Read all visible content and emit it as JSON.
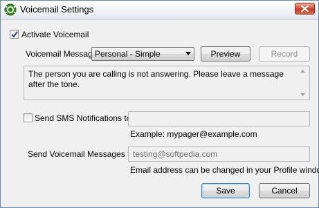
{
  "window": {
    "title": "Voicemail Settings"
  },
  "activate": {
    "label": "Activate Voicemail",
    "checked": true
  },
  "message": {
    "label": "Voicemail Message:",
    "selected": "Personal - Simple",
    "preview_label": "Preview",
    "record_label": "Record",
    "text": "The person you are calling is not answering. Please leave a message after the tone."
  },
  "sms": {
    "label": "Send SMS Notifications to:",
    "checked": false,
    "value": "",
    "example": "Example: mypager@example.com"
  },
  "send_to": {
    "label": "Send Voicemail Messages to:",
    "value": "testing@softpedia.com",
    "note": "Email address can be changed in your Profile window."
  },
  "buttons": {
    "save_label": "Save",
    "cancel_label": "Cancel"
  },
  "icons": {
    "app": "app-globe-icon",
    "close": "close-icon",
    "check": "checkmark-icon",
    "dropdown": "chevron-down-icon",
    "scroll_up": "scroll-up-icon",
    "scroll_down": "scroll-down-icon"
  },
  "colors": {
    "close_button": "#c2381f",
    "default_button_border": "#3c7fb1"
  }
}
